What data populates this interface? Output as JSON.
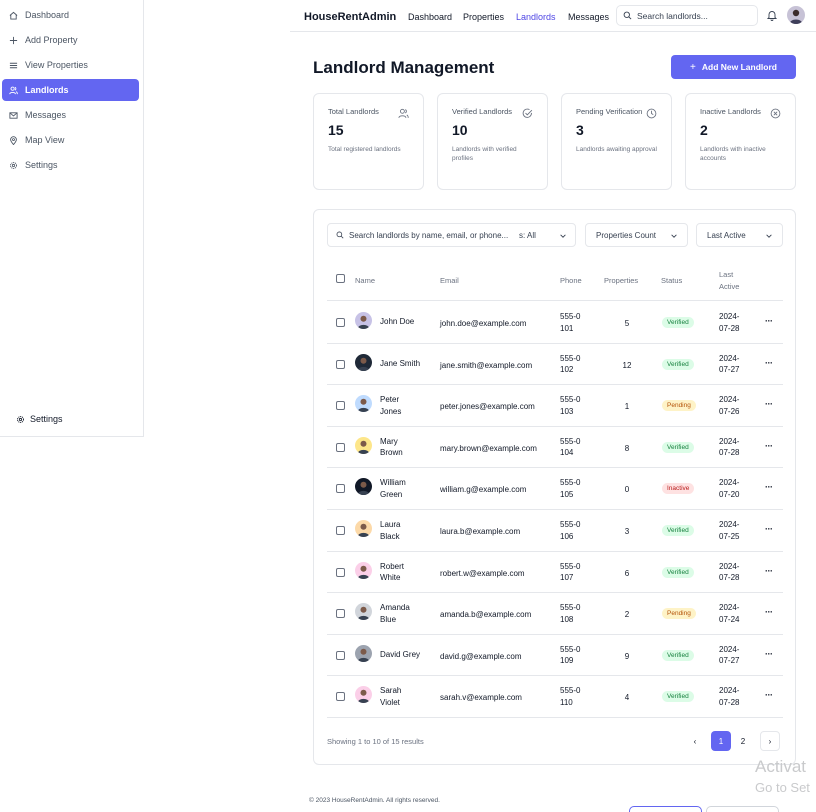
{
  "app": {
    "brand": "HouseRentAdmin"
  },
  "sidebar": {
    "items": [
      {
        "label": "Dashboard",
        "icon": "home-icon"
      },
      {
        "label": "Add Property",
        "icon": "plus-icon"
      },
      {
        "label": "View Properties",
        "icon": "list-icon"
      },
      {
        "label": "Landlords",
        "icon": "users-icon",
        "active": true
      },
      {
        "label": "Messages",
        "icon": "mail-icon"
      },
      {
        "label": "Map View",
        "icon": "map-pin-icon"
      },
      {
        "label": "Settings",
        "icon": "gear-icon"
      }
    ],
    "bottom_settings": "Settings"
  },
  "nav": {
    "links": [
      "Dashboard",
      "Properties",
      "Landlords",
      "Messages"
    ],
    "active": "Landlords",
    "search_placeholder": "Search landlords..."
  },
  "page": {
    "title": "Landlord Management",
    "add_button": "Add New Landlord"
  },
  "stats": [
    {
      "title": "Total Landlords",
      "value": "15",
      "desc": "Total registered landlords",
      "icon": "users-icon"
    },
    {
      "title": "Verified Landlords",
      "value": "10",
      "desc": "Landlords with verified profiles",
      "icon": "check-circle-icon"
    },
    {
      "title": "Pending Verification",
      "value": "3",
      "desc": "Landlords awaiting approval",
      "icon": "clock-icon"
    },
    {
      "title": "Inactive Landlords",
      "value": "2",
      "desc": "Landlords with inactive accounts",
      "icon": "x-circle-icon"
    }
  ],
  "filters": {
    "search_placeholder": "Search landlords by name, email, or phone...",
    "status_value": "s: All",
    "properties_count": "Properties Count",
    "last_active": "Last Active"
  },
  "table": {
    "columns": {
      "name": "Name",
      "email": "Email",
      "phone": "Phone",
      "properties": "Properties",
      "status": "Status",
      "last_active_1": "Last",
      "last_active_2": "Active"
    },
    "rows": [
      {
        "name1": "John Doe",
        "name2": "",
        "email": "john.doe@example.com",
        "phone1": "555-0",
        "phone2": "101",
        "properties": "5",
        "status": "Verified",
        "date1": "2024-",
        "date2": "07-28",
        "avatar_bg": "#c7c2e6"
      },
      {
        "name1": "Jane Smith",
        "name2": "",
        "email": "jane.smith@example.com",
        "phone1": "555-0",
        "phone2": "102",
        "properties": "12",
        "status": "Verified",
        "date1": "2024-",
        "date2": "07-27",
        "avatar_bg": "#1f2937"
      },
      {
        "name1": "Peter",
        "name2": "Jones",
        "email": "peter.jones@example.com",
        "phone1": "555-0",
        "phone2": "103",
        "properties": "1",
        "status": "Pending",
        "date1": "2024-",
        "date2": "07-26",
        "avatar_bg": "#bfdbfe"
      },
      {
        "name1": "Mary",
        "name2": "Brown",
        "email": "mary.brown@example.com",
        "phone1": "555-0",
        "phone2": "104",
        "properties": "8",
        "status": "Verified",
        "date1": "2024-",
        "date2": "07-28",
        "avatar_bg": "#fde68a"
      },
      {
        "name1": "William",
        "name2": "Green",
        "email": "william.g@example.com",
        "phone1": "555-0",
        "phone2": "105",
        "properties": "0",
        "status": "Inactive",
        "date1": "2024-",
        "date2": "07-20",
        "avatar_bg": "#111827"
      },
      {
        "name1": "Laura",
        "name2": "Black",
        "email": "laura.b@example.com",
        "phone1": "555-0",
        "phone2": "106",
        "properties": "3",
        "status": "Verified",
        "date1": "2024-",
        "date2": "07-25",
        "avatar_bg": "#fcd9a8"
      },
      {
        "name1": "Robert",
        "name2": "White",
        "email": "robert.w@example.com",
        "phone1": "555-0",
        "phone2": "107",
        "properties": "6",
        "status": "Verified",
        "date1": "2024-",
        "date2": "07-28",
        "avatar_bg": "#fbcfe8"
      },
      {
        "name1": "Amanda",
        "name2": "Blue",
        "email": "amanda.b@example.com",
        "phone1": "555-0",
        "phone2": "108",
        "properties": "2",
        "status": "Pending",
        "date1": "2024-",
        "date2": "07-24",
        "avatar_bg": "#d1d5db"
      },
      {
        "name1": "David Grey",
        "name2": "",
        "email": "david.g@example.com",
        "phone1": "555-0",
        "phone2": "109",
        "properties": "9",
        "status": "Verified",
        "date1": "2024-",
        "date2": "07-27",
        "avatar_bg": "#9ca3af"
      },
      {
        "name1": "Sarah",
        "name2": "Violet",
        "email": "sarah.v@example.com",
        "phone1": "555-0",
        "phone2": "110",
        "properties": "4",
        "status": "Verified",
        "date1": "2024-",
        "date2": "07-28",
        "avatar_bg": "#fbcfe8"
      }
    ]
  },
  "pagination": {
    "summary": "Showing 1 to 10 of 15 results",
    "prev": "‹",
    "pages": [
      "1",
      "2"
    ],
    "current": "1",
    "next": "›"
  },
  "footer": "© 2023 HouseRentAdmin. All rights reserved.",
  "watermark": {
    "line1": "Activat",
    "line2": "Go to Set"
  },
  "colors": {
    "accent": "#6366f1",
    "verified": "#15803d",
    "pending": "#b45309",
    "inactive": "#b91c1c"
  }
}
